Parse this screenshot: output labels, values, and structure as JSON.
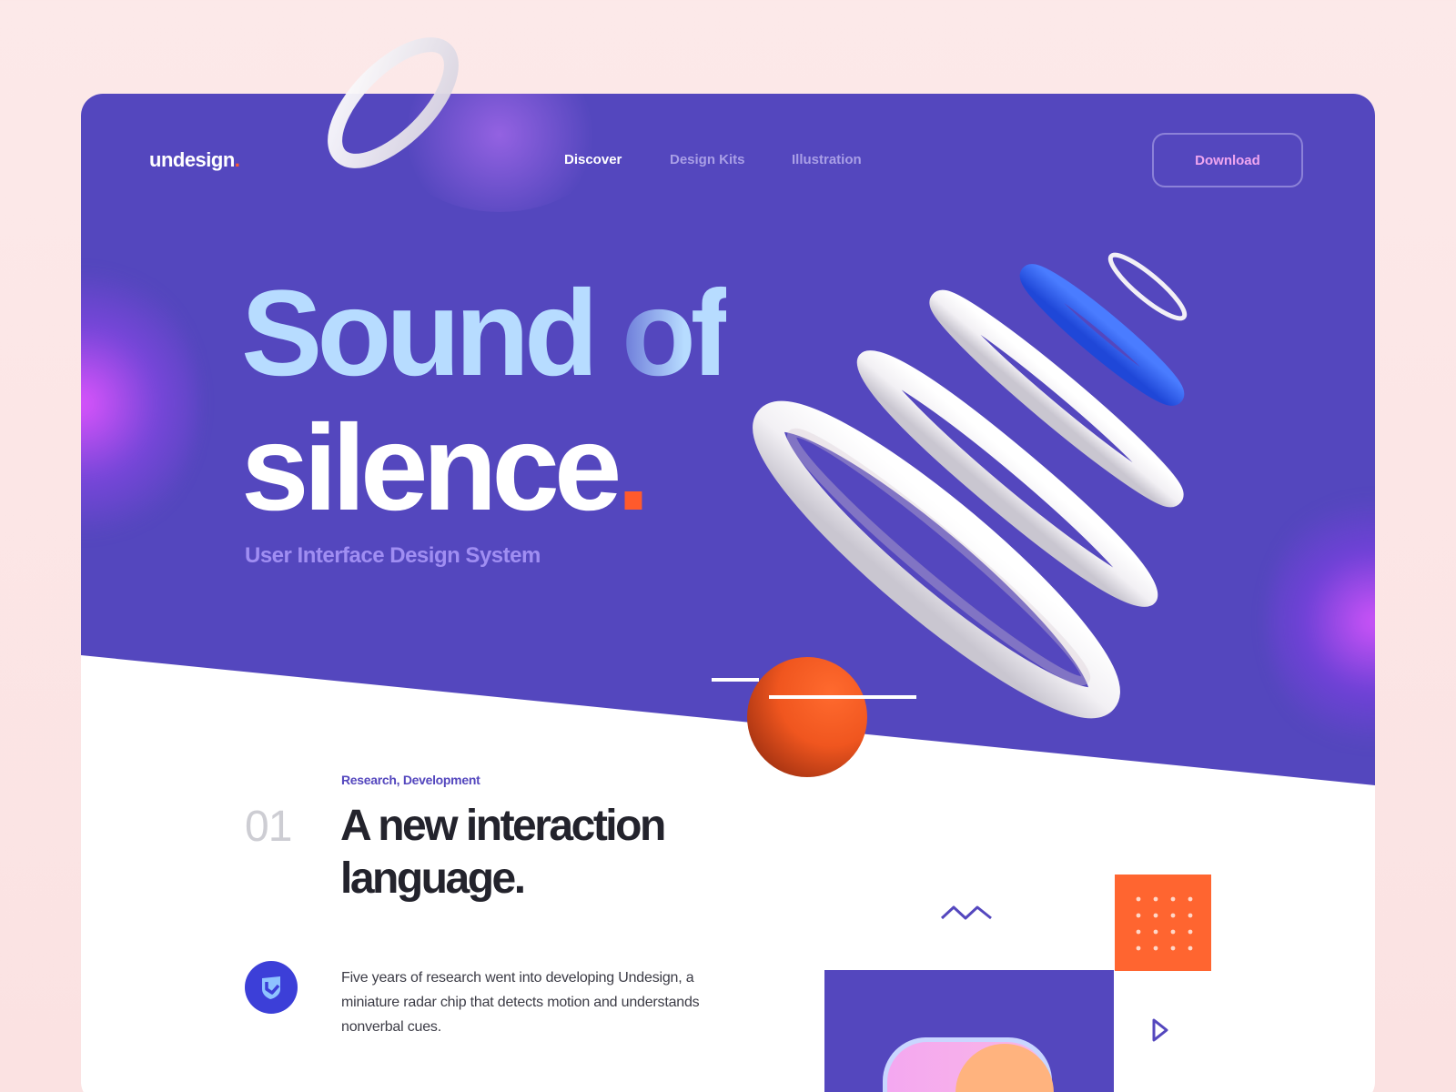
{
  "brand": {
    "name": "undesign",
    "dot": "."
  },
  "nav": {
    "items": [
      {
        "label": "Discover",
        "active": true
      },
      {
        "label": "Design Kits",
        "active": false
      },
      {
        "label": "Illustration",
        "active": false
      }
    ],
    "download_label": "Download"
  },
  "hero": {
    "headline_word1": "Sound",
    "headline_word2": "of",
    "headline_line2": "silence",
    "headline_dot": ".",
    "subtitle": "User Interface Design System"
  },
  "feature": {
    "category": "Research, Development",
    "number": "01",
    "title": "A new interaction language.",
    "body": "Five years of research went into developing Undesign, a miniature radar chip that detects motion and understands nonverbal cues."
  },
  "colors": {
    "hero_bg": "#5447be",
    "accent_orange": "#ff5a2c",
    "headline_light_blue": "#b7dcff",
    "subtitle_purple": "#a08ef2",
    "ring_blue": "#2e5ef0",
    "page_bg": "#fce9e9"
  },
  "icons": [
    "shield-badge-icon",
    "zigzag-icon",
    "play-triangle-icon",
    "dot-grid-icon"
  ]
}
